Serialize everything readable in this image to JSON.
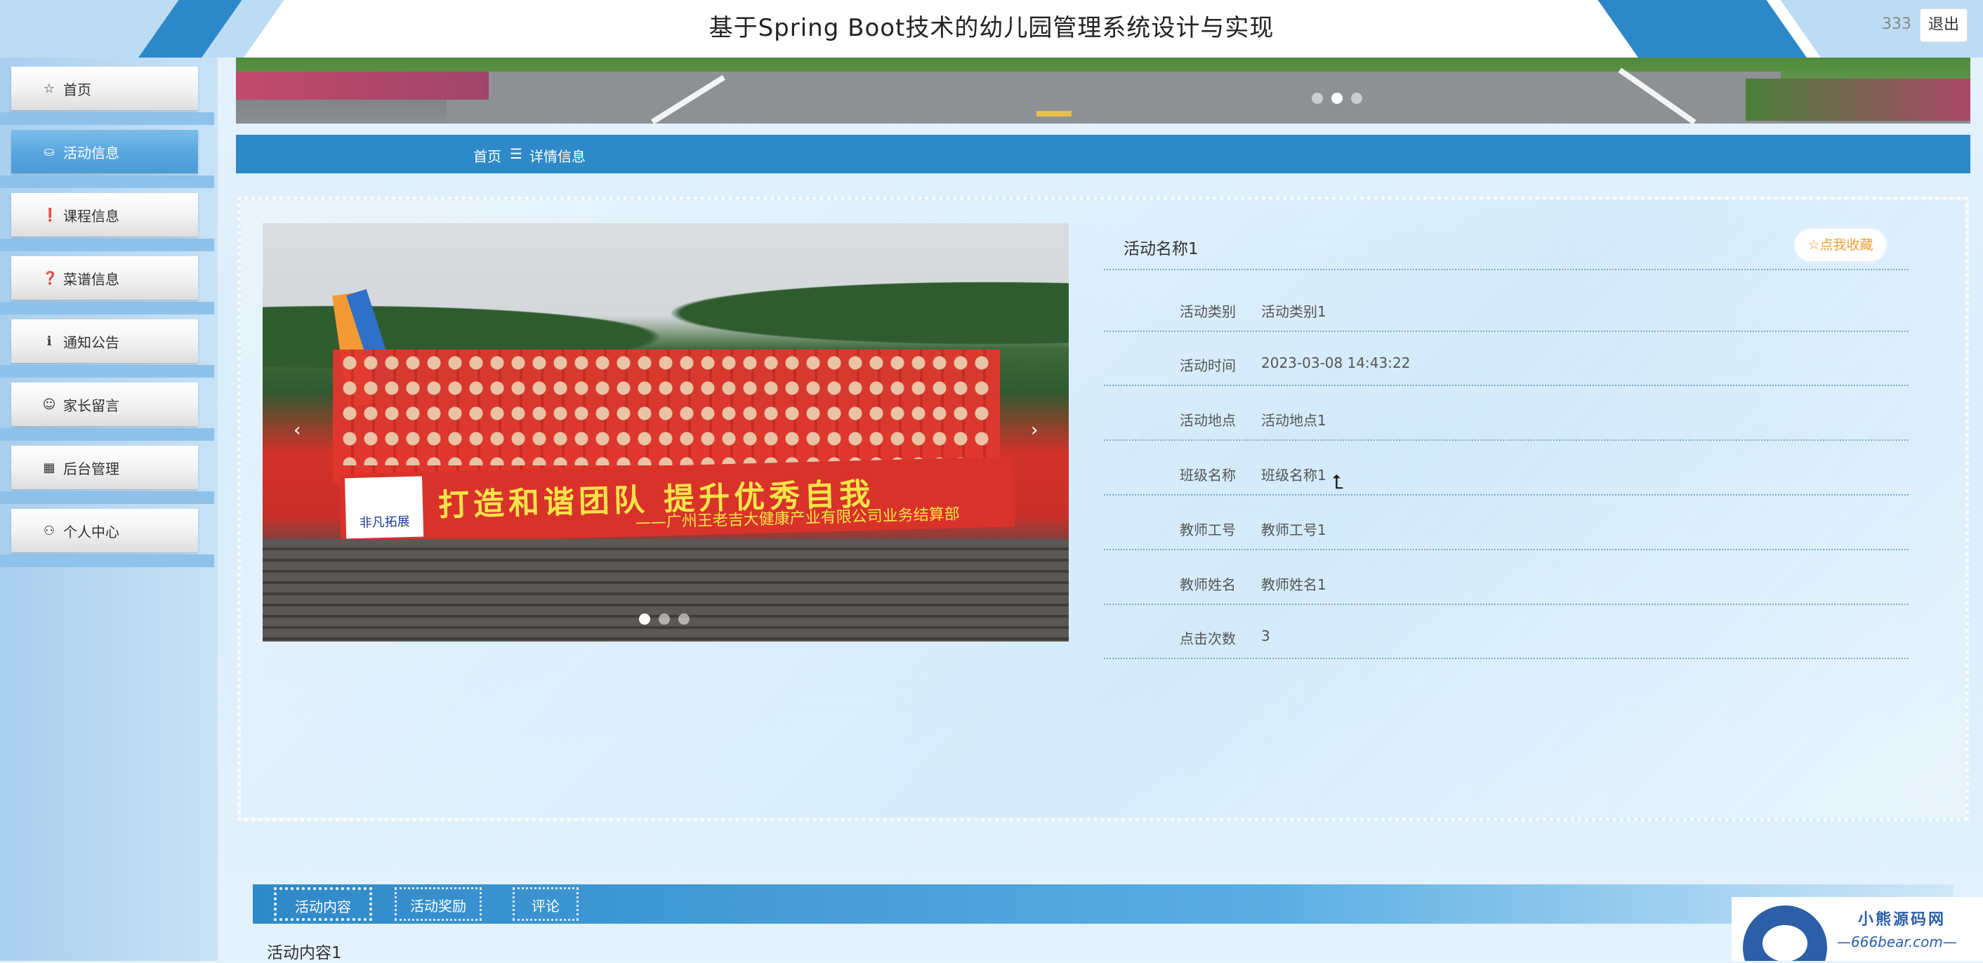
{
  "header": {
    "title": "基于Spring Boot技术的幼儿园管理系统设计与实现",
    "username": "333",
    "logout_label": "退出"
  },
  "sidebar": {
    "items": [
      {
        "label": "首页",
        "icon": "star-outline-icon",
        "glyph": "☆",
        "active": false
      },
      {
        "label": "活动信息",
        "icon": "shopping-bag-icon",
        "glyph": "⛀",
        "active": true
      },
      {
        "label": "课程信息",
        "icon": "exclamation-circle-icon",
        "glyph": "❗",
        "active": false
      },
      {
        "label": "菜谱信息",
        "icon": "question-circle-icon",
        "glyph": "❓",
        "active": false
      },
      {
        "label": "通知公告",
        "icon": "info-circle-icon",
        "glyph": "ℹ",
        "active": false
      },
      {
        "label": "家长留言",
        "icon": "smiley-icon",
        "glyph": "☺",
        "active": false
      },
      {
        "label": "后台管理",
        "icon": "calendar-icon",
        "glyph": "▦",
        "active": false
      },
      {
        "label": "个人中心",
        "icon": "user-icon",
        "glyph": "⚇",
        "active": false
      }
    ]
  },
  "banner": {
    "slides_total": 3,
    "active_slide": 2
  },
  "breadcrumb": {
    "home": "首页",
    "separator": "☰",
    "current": "详情信息"
  },
  "detail": {
    "name": "活动名称1",
    "collect_label": "☆点我收藏",
    "photo": {
      "slogan": "打造和谐团队  提升优秀自我",
      "subline": "——广州王老吉大健康产业有限公司业务结算部",
      "logo_text": "非凡拓展",
      "slides_total": 3,
      "active_slide": 1,
      "prev": "‹",
      "next": "›"
    },
    "fields": [
      {
        "label": "活动类别",
        "value": "活动类别1"
      },
      {
        "label": "活动时间",
        "value": "2023-03-08 14:43:22"
      },
      {
        "label": "活动地点",
        "value": "活动地点1"
      },
      {
        "label": "班级名称",
        "value": "班级名称1"
      },
      {
        "label": "教师工号",
        "value": "教师工号1"
      },
      {
        "label": "教师姓名",
        "value": "教师姓名1"
      },
      {
        "label": "点击次数",
        "value": "3"
      }
    ]
  },
  "tabs": {
    "items": [
      {
        "label": "活动内容",
        "active": true
      },
      {
        "label": "活动奖励",
        "active": false
      },
      {
        "label": "评论",
        "active": false
      }
    ],
    "content": "活动内容1"
  },
  "watermark": {
    "line1": "小熊源码网",
    "line2": "—666bear.com—"
  },
  "colors": {
    "primary": "#2e89c9",
    "accent": "#f0a03a",
    "sidebar_active": "#5aa7df"
  }
}
